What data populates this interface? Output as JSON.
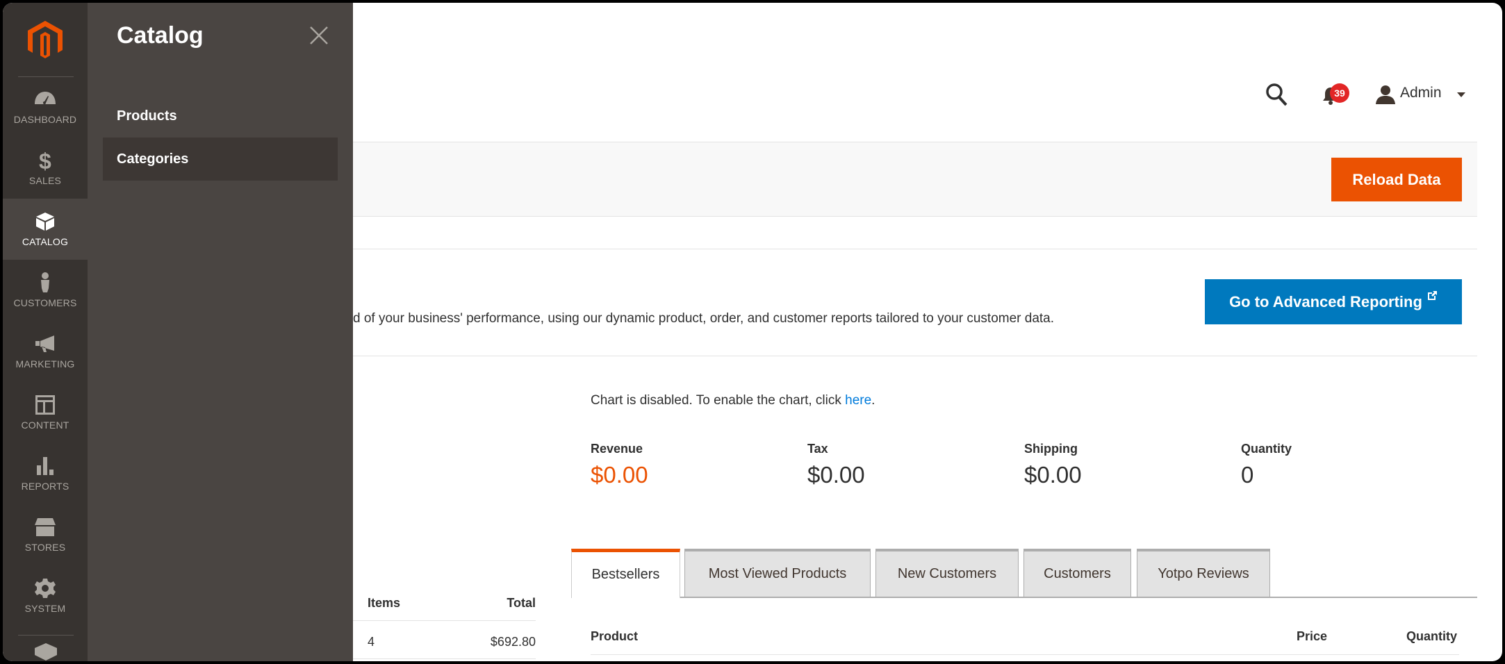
{
  "nav": {
    "items": [
      {
        "label": "DASHBOARD",
        "icon": "dashboard-icon"
      },
      {
        "label": "SALES",
        "icon": "dollar-icon"
      },
      {
        "label": "CATALOG",
        "icon": "box-icon",
        "active": true
      },
      {
        "label": "CUSTOMERS",
        "icon": "person-icon"
      },
      {
        "label": "MARKETING",
        "icon": "megaphone-icon"
      },
      {
        "label": "CONTENT",
        "icon": "layout-icon"
      },
      {
        "label": "REPORTS",
        "icon": "bar-chart-icon"
      },
      {
        "label": "STORES",
        "icon": "store-icon"
      },
      {
        "label": "SYSTEM",
        "icon": "gear-icon"
      }
    ]
  },
  "flyout": {
    "title": "Catalog",
    "items": [
      {
        "label": "Products"
      },
      {
        "label": "Categories",
        "selected": true
      }
    ]
  },
  "header": {
    "notifications_count": "39",
    "user": "Admin"
  },
  "toolbar": {
    "reload_label": "Reload Data"
  },
  "advanced": {
    "description": "d of your business' performance, using our dynamic product, order, and customer reports tailored to your customer data.",
    "button_label": "Go to Advanced Reporting"
  },
  "chart_notice": {
    "text": "Chart is disabled. To enable the chart, click ",
    "link": "here",
    "suffix": "."
  },
  "totals": [
    {
      "label": "Revenue",
      "value": "$0.00"
    },
    {
      "label": "Tax",
      "value": "$0.00"
    },
    {
      "label": "Shipping",
      "value": "$0.00"
    },
    {
      "label": "Quantity",
      "value": "0"
    }
  ],
  "orders_table": {
    "headers": [
      "Items",
      "Total"
    ],
    "rows": [
      [
        "4",
        "$692.80"
      ]
    ]
  },
  "tabs": [
    "Bestsellers",
    "Most Viewed Products",
    "New Customers",
    "Customers",
    "Yotpo Reviews"
  ],
  "bestsellers_table": {
    "headers": [
      "Product",
      "Price",
      "Quantity"
    ]
  },
  "colors": {
    "accent": "#eb5202",
    "primary_button": "#0079be",
    "nav_bg": "#373330",
    "flyout_bg": "#4a4542",
    "badge": "#e22626",
    "link": "#007bdb"
  }
}
